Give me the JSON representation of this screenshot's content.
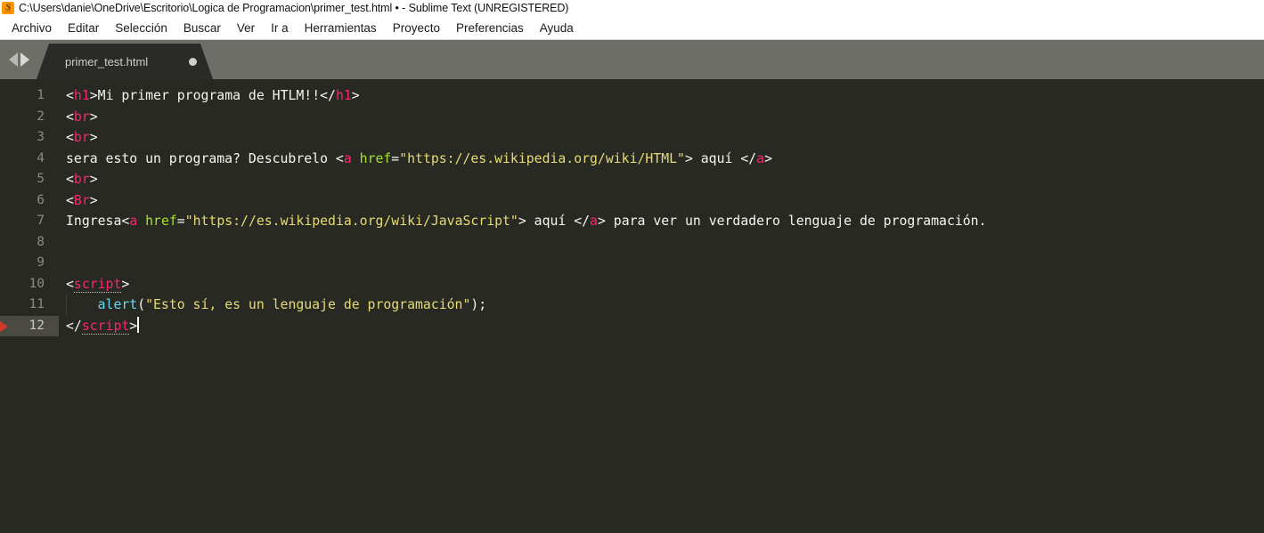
{
  "window": {
    "title": "C:\\Users\\danie\\OneDrive\\Escritorio\\Logica de Programacion\\primer_test.html • - Sublime Text (UNREGISTERED)",
    "app_icon": "sublime-text-logo"
  },
  "menubar": {
    "items": [
      {
        "label": "Archivo"
      },
      {
        "label": "Editar"
      },
      {
        "label": "Selección"
      },
      {
        "label": "Buscar"
      },
      {
        "label": "Ver"
      },
      {
        "label": "Ir a"
      },
      {
        "label": "Herramientas"
      },
      {
        "label": "Proyecto"
      },
      {
        "label": "Preferencias"
      },
      {
        "label": "Ayuda"
      }
    ]
  },
  "tabbar": {
    "prev_icon": "chevron-left-icon",
    "next_icon": "chevron-right-icon",
    "tabs": [
      {
        "label": "primer_test.html",
        "dirty": true,
        "active": true
      }
    ]
  },
  "editor": {
    "active_line": 12,
    "gutter_marker_line": 12,
    "line_numbers": [
      1,
      2,
      3,
      4,
      5,
      6,
      7,
      8,
      9,
      10,
      11,
      12
    ],
    "colors": {
      "background": "#282923",
      "gutter_text": "#8c8c82",
      "active_line_gutter": "#4a4a43",
      "plain_text": "#f6f6ef",
      "tag": "#f92672",
      "attribute": "#a6e22e",
      "string": "#e6db74",
      "function": "#66d9ef",
      "marker": "#d23b2c",
      "tabbar": "#6e6e68",
      "tab_active": "#2a2a26"
    },
    "lines": [
      {
        "n": 1,
        "tokens": [
          {
            "t": "punc",
            "v": "<"
          },
          {
            "t": "tag",
            "v": "h1"
          },
          {
            "t": "punc",
            "v": ">"
          },
          {
            "t": "txt",
            "v": "Mi primer programa de HTLM!!"
          },
          {
            "t": "punc",
            "v": "</"
          },
          {
            "t": "tag",
            "v": "h1"
          },
          {
            "t": "punc",
            "v": ">"
          }
        ]
      },
      {
        "n": 2,
        "tokens": [
          {
            "t": "punc",
            "v": "<"
          },
          {
            "t": "tag",
            "v": "br"
          },
          {
            "t": "punc",
            "v": ">"
          }
        ]
      },
      {
        "n": 3,
        "tokens": [
          {
            "t": "punc",
            "v": "<"
          },
          {
            "t": "tag",
            "v": "br"
          },
          {
            "t": "punc",
            "v": ">"
          }
        ]
      },
      {
        "n": 4,
        "tokens": [
          {
            "t": "txt",
            "v": "sera esto un programa? Descubrelo "
          },
          {
            "t": "punc",
            "v": "<"
          },
          {
            "t": "tag",
            "v": "a"
          },
          {
            "t": "txt",
            "v": " "
          },
          {
            "t": "attr",
            "v": "href"
          },
          {
            "t": "punc",
            "v": "="
          },
          {
            "t": "str",
            "v": "\"https://es.wikipedia.org/wiki/HTML\""
          },
          {
            "t": "punc",
            "v": ">"
          },
          {
            "t": "txt",
            "v": " aquí "
          },
          {
            "t": "punc",
            "v": "</"
          },
          {
            "t": "tag",
            "v": "a"
          },
          {
            "t": "punc",
            "v": ">"
          }
        ]
      },
      {
        "n": 5,
        "tokens": [
          {
            "t": "punc",
            "v": "<"
          },
          {
            "t": "tag",
            "v": "br"
          },
          {
            "t": "punc",
            "v": ">"
          }
        ]
      },
      {
        "n": 6,
        "tokens": [
          {
            "t": "punc",
            "v": "<"
          },
          {
            "t": "tag",
            "v": "Br"
          },
          {
            "t": "punc",
            "v": ">"
          }
        ]
      },
      {
        "n": 7,
        "tokens": [
          {
            "t": "txt",
            "v": "Ingresa"
          },
          {
            "t": "punc",
            "v": "<"
          },
          {
            "t": "tag",
            "v": "a"
          },
          {
            "t": "txt",
            "v": " "
          },
          {
            "t": "attr",
            "v": "href"
          },
          {
            "t": "punc",
            "v": "="
          },
          {
            "t": "str",
            "v": "\"https://es.wikipedia.org/wiki/JavaScript\""
          },
          {
            "t": "punc",
            "v": ">"
          },
          {
            "t": "txt",
            "v": " aquí "
          },
          {
            "t": "punc",
            "v": "</"
          },
          {
            "t": "tag",
            "v": "a"
          },
          {
            "t": "punc",
            "v": ">"
          },
          {
            "t": "txt",
            "v": " para ver un verdadero lenguaje de programación."
          }
        ]
      },
      {
        "n": 8,
        "tokens": []
      },
      {
        "n": 9,
        "tokens": []
      },
      {
        "n": 10,
        "tokens": [
          {
            "t": "punc",
            "v": "<"
          },
          {
            "t": "tag-u",
            "v": "script"
          },
          {
            "t": "punc",
            "v": ">"
          }
        ]
      },
      {
        "n": 11,
        "tokens": [
          {
            "t": "guide",
            "v": "    "
          },
          {
            "t": "fn",
            "v": "alert"
          },
          {
            "t": "punc",
            "v": "("
          },
          {
            "t": "str",
            "v": "\"Esto sí, es un lenguaje de programación\""
          },
          {
            "t": "punc",
            "v": ");"
          }
        ]
      },
      {
        "n": 12,
        "tokens": [
          {
            "t": "punc",
            "v": "</"
          },
          {
            "t": "tag-u",
            "v": "script"
          },
          {
            "t": "punc",
            "v": ">"
          },
          {
            "t": "caret",
            "v": ""
          }
        ]
      }
    ]
  }
}
